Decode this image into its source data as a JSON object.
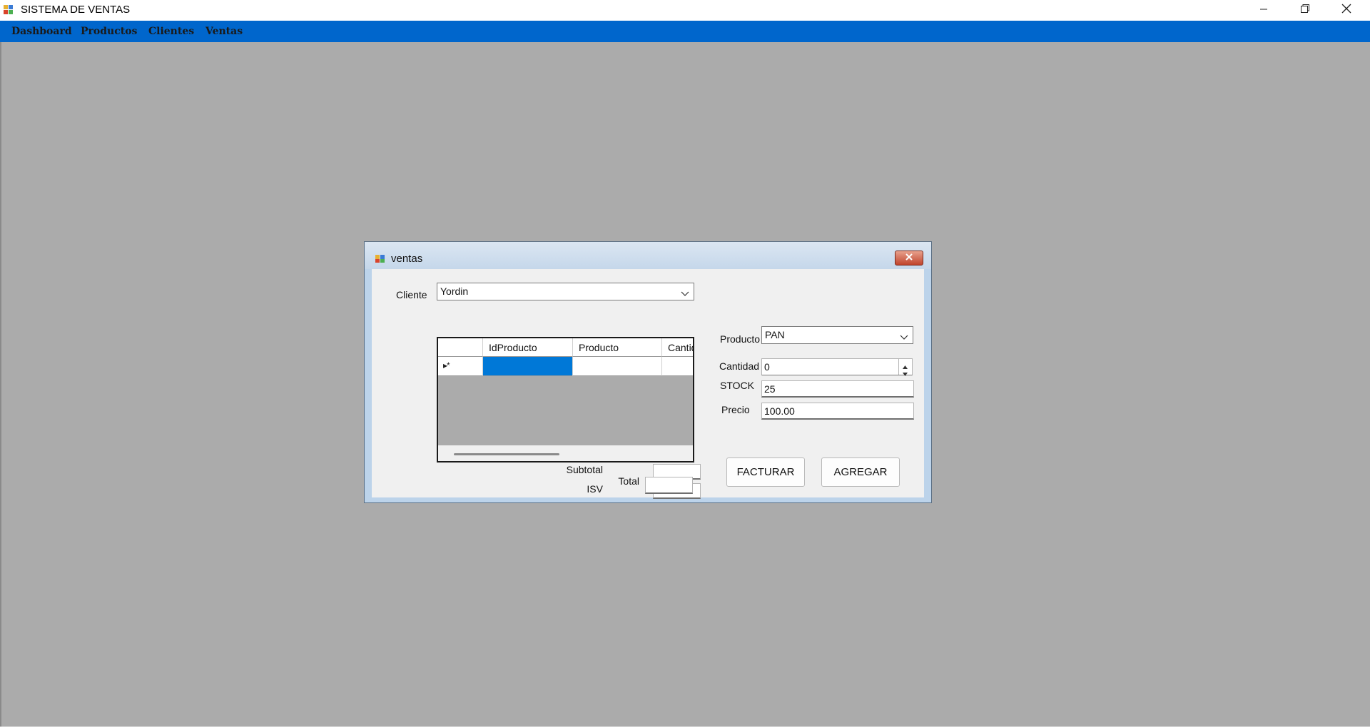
{
  "window": {
    "title": "SISTEMA DE VENTAS",
    "icons": [
      "app-icon",
      "minimize-icon",
      "restore-icon",
      "close-icon"
    ]
  },
  "menu": {
    "items": [
      "Dashboard",
      "Productos",
      "Clientes",
      "Ventas"
    ]
  },
  "dialog": {
    "title": "ventas",
    "icons": [
      "ventas-icon",
      "close-icon"
    ],
    "cliente": {
      "label": "Cliente",
      "value": "Yordin"
    },
    "grid": {
      "columns": [
        "IdProducto",
        "Producto",
        "Cantid"
      ],
      "new_row_marker": "▸*",
      "rows": []
    },
    "totals": {
      "subtotal_label": "Subtotal",
      "subtotal_value": "",
      "isv_label": "ISV",
      "isv_value": "",
      "total_label": "Total",
      "total_value": ""
    },
    "producto": {
      "label": "Producto",
      "value": "PAN"
    },
    "cantidad": {
      "label": "Cantidad",
      "value": "0"
    },
    "stock": {
      "label": "STOCK",
      "value": "25"
    },
    "precio": {
      "label": "Precio",
      "value": "100.00"
    },
    "buttons": {
      "facturar": "FACTURAR",
      "agregar": "AGREGAR"
    }
  },
  "colors": {
    "menubar": "#0066cc",
    "mdi_background": "#ababab",
    "selected_cell": "#0078d7"
  }
}
